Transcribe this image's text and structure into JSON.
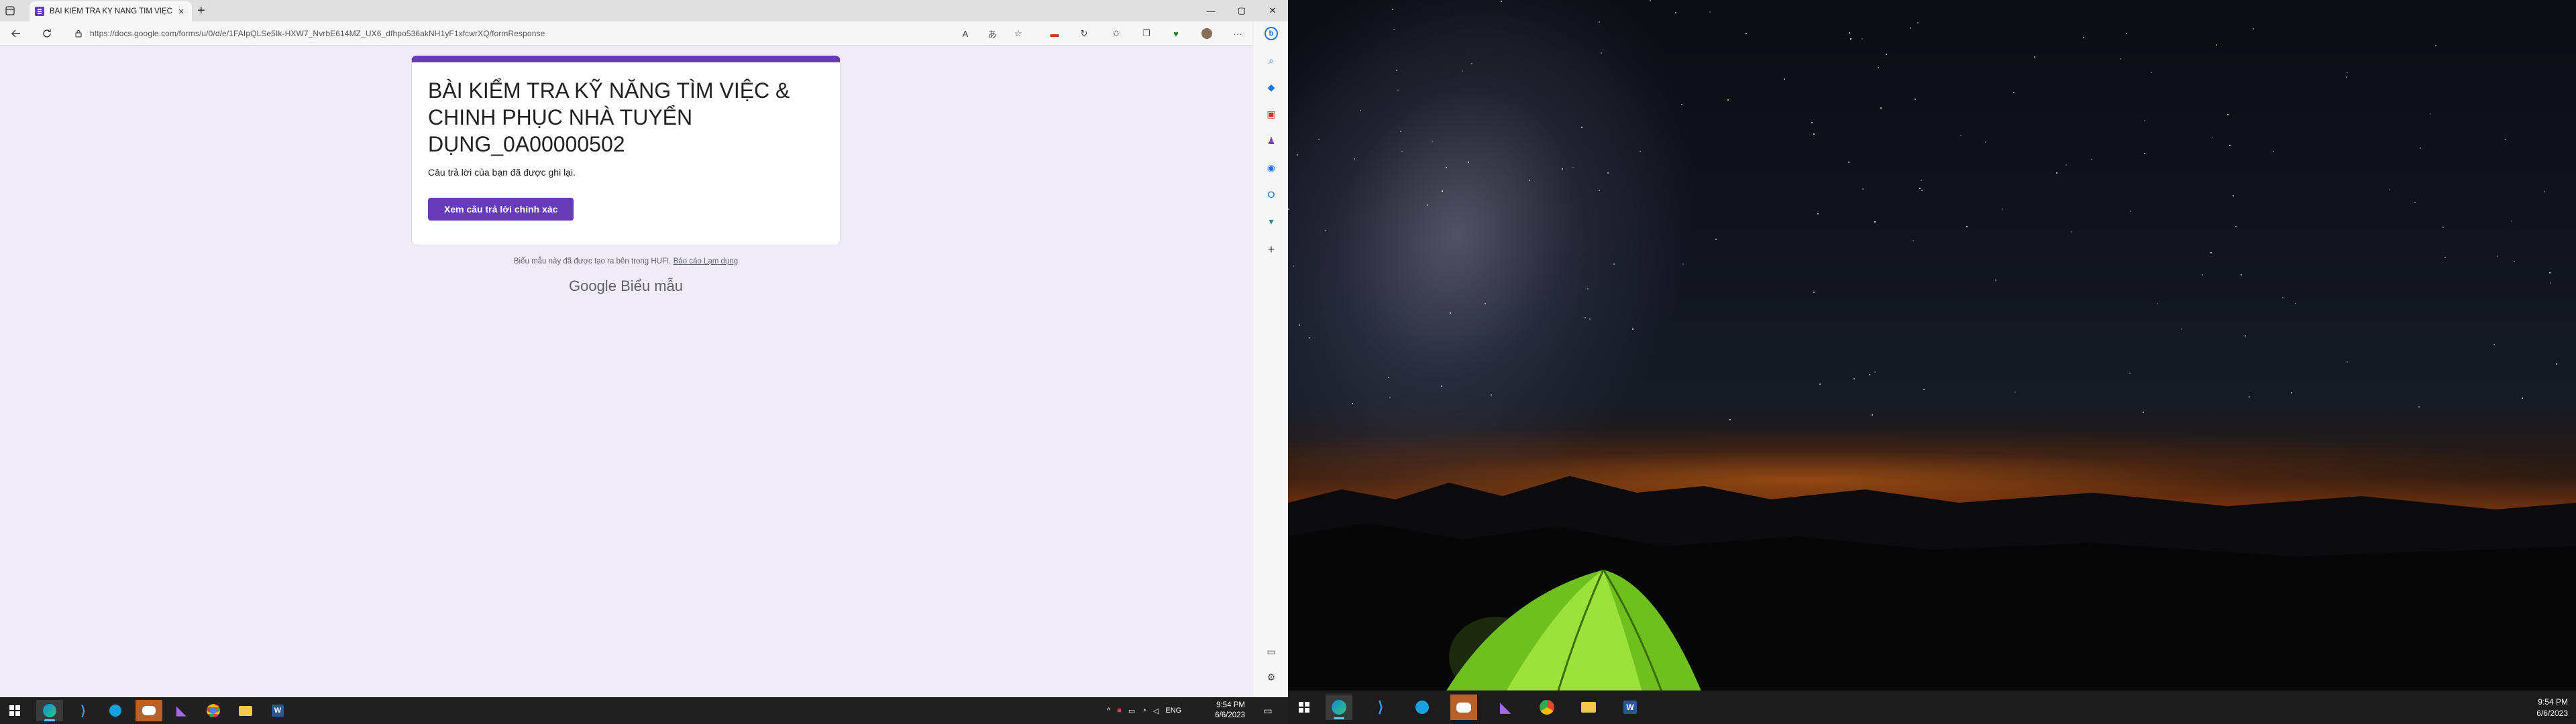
{
  "browser": {
    "tab_title": "BÀI KIỂM TRA KỸ NĂNG TÌM VIỆC",
    "url": "https://docs.google.com/forms/u/0/d/e/1FAIpQLSe5Ik-HXW7_NvrbE614MZ_UX6_dfhpo536akNH1yF1xfcwrXQ/formResponse"
  },
  "form": {
    "title": "BÀI KIỂM TRA KỸ NĂNG TÌM VIỆC & CHINH PHỤC NHÀ TUYỂN DỤNG_0A00000502",
    "confirmation": "Câu trả lời của bạn đã được ghi lại.",
    "view_answers_label": "Xem câu trả lời chính xác",
    "footer_text": "Biểu mẫu này đã được tạo ra bên trong HUFI.",
    "report_label": "Báo cáo Lạm dụng",
    "google_label": "Google",
    "forms_label": "Biểu mẫu"
  },
  "taskbar_left": {
    "language": "ENG",
    "time": "9:54 PM",
    "date": "6/6/2023"
  },
  "taskbar_right": {
    "time": "9:54 PM",
    "date": "6/6/2023"
  },
  "colors": {
    "accent": "#673ab7",
    "page_bg": "#f0ebf8"
  }
}
